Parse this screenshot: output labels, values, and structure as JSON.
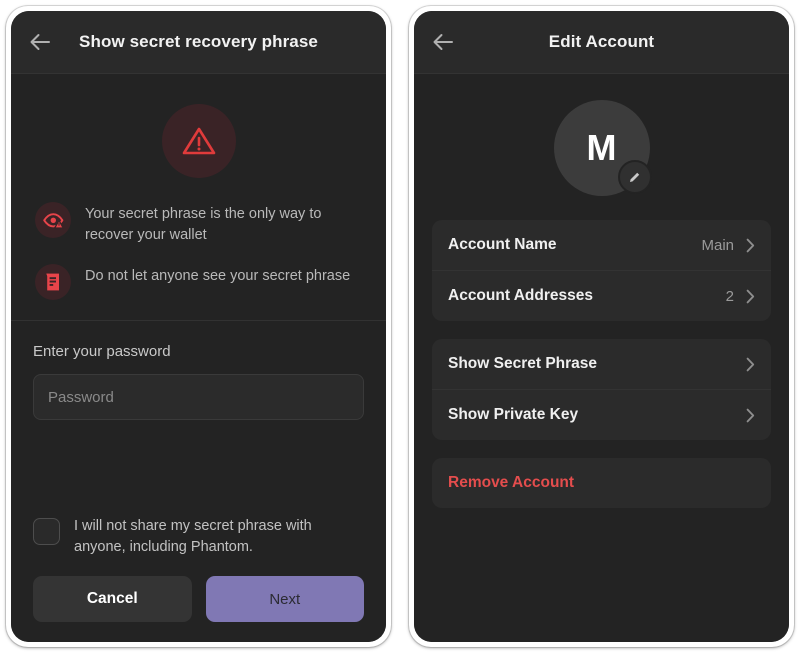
{
  "left_panel": {
    "header": {
      "back_icon": "arrow-left-icon",
      "title": "Show secret recovery phrase"
    },
    "hero_icon": "warning-triangle-icon",
    "bullets": [
      {
        "icon": "eye-warning-icon",
        "text": "Your secret phrase is the only way to recover your wallet"
      },
      {
        "icon": "document-warning-icon",
        "text": "Do not let anyone see your secret phrase"
      }
    ],
    "password": {
      "label": "Enter your password",
      "placeholder": "Password",
      "value": ""
    },
    "consent": {
      "checked": false,
      "text": "I will not share my secret phrase with anyone, including Phantom."
    },
    "buttons": {
      "cancel": "Cancel",
      "next": "Next"
    }
  },
  "right_panel": {
    "header": {
      "back_icon": "arrow-left-icon",
      "title": "Edit Account"
    },
    "avatar": {
      "initial": "M",
      "edit_icon": "pencil-icon"
    },
    "groups": [
      {
        "rows": [
          {
            "label": "Account Name",
            "value": "Main",
            "chevron": "chevron-right-icon"
          },
          {
            "label": "Account Addresses",
            "value": "2",
            "chevron": "chevron-right-icon"
          }
        ]
      },
      {
        "rows": [
          {
            "label": "Show Secret Phrase",
            "value": "",
            "chevron": "chevron-right-icon"
          },
          {
            "label": "Show Private Key",
            "value": "",
            "chevron": "chevron-right-icon"
          }
        ]
      }
    ],
    "danger": {
      "label": "Remove Account"
    }
  },
  "colors": {
    "screen_bg": "#232323",
    "header_bg": "#2a2a2a",
    "card_bg": "#2b2b2b",
    "accent_purple": "#8078b4",
    "danger_red": "#e44d4d",
    "warn_red": "#e03b3b",
    "warn_circle_bg": "#3a2326"
  }
}
